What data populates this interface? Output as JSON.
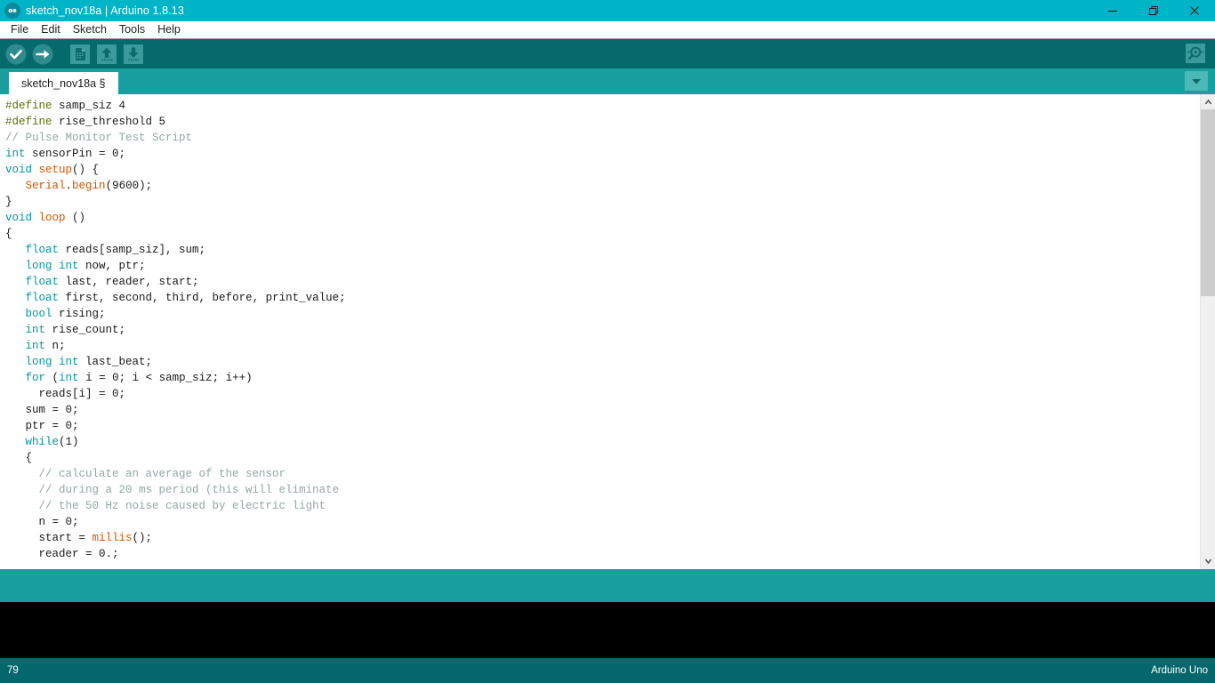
{
  "window": {
    "title": "sketch_nov18a | Arduino 1.8.13",
    "logo_icon": "arduino-infinity-icon",
    "controls": {
      "minimize": "minimize-icon",
      "maximize": "restore-icon",
      "close": "close-icon"
    }
  },
  "menubar": {
    "items": [
      {
        "label": "File"
      },
      {
        "label": "Edit"
      },
      {
        "label": "Sketch"
      },
      {
        "label": "Tools"
      },
      {
        "label": "Help"
      }
    ]
  },
  "toolbar": {
    "buttons": [
      {
        "name": "verify",
        "icon": "check-circle-icon",
        "tooltip": "Verify"
      },
      {
        "name": "upload",
        "icon": "arrow-right-circle-icon",
        "tooltip": "Upload"
      },
      {
        "name": "new",
        "icon": "new-file-icon",
        "tooltip": "New"
      },
      {
        "name": "open",
        "icon": "arrow-up-folder-icon",
        "tooltip": "Open"
      },
      {
        "name": "save",
        "icon": "arrow-down-save-icon",
        "tooltip": "Save"
      }
    ],
    "serial_monitor": {
      "name": "serial-monitor",
      "icon": "magnifier-icon",
      "tooltip": "Serial Monitor"
    }
  },
  "tabs": {
    "items": [
      {
        "label": "sketch_nov18a §",
        "active": true
      }
    ],
    "dropdown_icon": "chevron-down-icon"
  },
  "editor": {
    "lines": [
      [
        {
          "t": "pre",
          "s": "#define"
        },
        {
          "t": "plain",
          "s": " samp_siz 4"
        }
      ],
      [
        {
          "t": "pre",
          "s": "#define"
        },
        {
          "t": "plain",
          "s": " rise_threshold 5"
        }
      ],
      [
        {
          "t": "cmt",
          "s": "// Pulse Monitor Test Script"
        }
      ],
      [
        {
          "t": "key",
          "s": "int"
        },
        {
          "t": "plain",
          "s": " sensorPin = 0;"
        }
      ],
      [
        {
          "t": "key",
          "s": "void"
        },
        {
          "t": "fn",
          "s": " setup"
        },
        {
          "t": "plain",
          "s": "() {"
        }
      ],
      [
        {
          "t": "plain",
          "s": "   "
        },
        {
          "t": "fn",
          "s": "Serial"
        },
        {
          "t": "plain",
          "s": "."
        },
        {
          "t": "fn",
          "s": "begin"
        },
        {
          "t": "plain",
          "s": "(9600);"
        }
      ],
      [
        {
          "t": "plain",
          "s": "}"
        }
      ],
      [
        {
          "t": "key",
          "s": "void"
        },
        {
          "t": "fn",
          "s": " loop"
        },
        {
          "t": "plain",
          "s": " ()"
        }
      ],
      [
        {
          "t": "plain",
          "s": "{"
        }
      ],
      [
        {
          "t": "plain",
          "s": "   "
        },
        {
          "t": "key",
          "s": "float"
        },
        {
          "t": "plain",
          "s": " reads[samp_siz], sum;"
        }
      ],
      [
        {
          "t": "plain",
          "s": "   "
        },
        {
          "t": "key",
          "s": "long int"
        },
        {
          "t": "plain",
          "s": " now, ptr;"
        }
      ],
      [
        {
          "t": "plain",
          "s": "   "
        },
        {
          "t": "key",
          "s": "float"
        },
        {
          "t": "plain",
          "s": " last, reader, start;"
        }
      ],
      [
        {
          "t": "plain",
          "s": "   "
        },
        {
          "t": "key",
          "s": "float"
        },
        {
          "t": "plain",
          "s": " first, second, third, before, print_value;"
        }
      ],
      [
        {
          "t": "plain",
          "s": "   "
        },
        {
          "t": "key",
          "s": "bool"
        },
        {
          "t": "plain",
          "s": " rising;"
        }
      ],
      [
        {
          "t": "plain",
          "s": "   "
        },
        {
          "t": "key",
          "s": "int"
        },
        {
          "t": "plain",
          "s": " rise_count;"
        }
      ],
      [
        {
          "t": "plain",
          "s": "   "
        },
        {
          "t": "key",
          "s": "int"
        },
        {
          "t": "plain",
          "s": " n;"
        }
      ],
      [
        {
          "t": "plain",
          "s": "   "
        },
        {
          "t": "key",
          "s": "long int"
        },
        {
          "t": "plain",
          "s": " last_beat;"
        }
      ],
      [
        {
          "t": "plain",
          "s": "   "
        },
        {
          "t": "key",
          "s": "for"
        },
        {
          "t": "plain",
          "s": " ("
        },
        {
          "t": "key",
          "s": "int"
        },
        {
          "t": "plain",
          "s": " i = 0; i < samp_siz; i++)"
        }
      ],
      [
        {
          "t": "plain",
          "s": "     reads[i] = 0;"
        }
      ],
      [
        {
          "t": "plain",
          "s": "   sum = 0;"
        }
      ],
      [
        {
          "t": "plain",
          "s": "   ptr = 0;"
        }
      ],
      [
        {
          "t": "plain",
          "s": "   "
        },
        {
          "t": "key",
          "s": "while"
        },
        {
          "t": "plain",
          "s": "(1)"
        }
      ],
      [
        {
          "t": "plain",
          "s": "   {"
        }
      ],
      [
        {
          "t": "plain",
          "s": "     "
        },
        {
          "t": "cmt",
          "s": "// calculate an average of the sensor"
        }
      ],
      [
        {
          "t": "plain",
          "s": "     "
        },
        {
          "t": "cmt",
          "s": "// during a 20 ms period (this will eliminate"
        }
      ],
      [
        {
          "t": "plain",
          "s": "     "
        },
        {
          "t": "cmt",
          "s": "// the 50 Hz noise caused by electric light"
        }
      ],
      [
        {
          "t": "plain",
          "s": "     n = 0;"
        }
      ],
      [
        {
          "t": "plain",
          "s": "     start = "
        },
        {
          "t": "fn",
          "s": "millis"
        },
        {
          "t": "plain",
          "s": "();"
        }
      ],
      [
        {
          "t": "plain",
          "s": "     reader = 0.;"
        }
      ]
    ],
    "scrollbar": {
      "up_arrow_icon": "chevron-up-icon",
      "down_arrow_icon": "chevron-down-icon"
    }
  },
  "console": {
    "text": ""
  },
  "statusbar": {
    "line_number": "79",
    "board": "Arduino Uno"
  },
  "colors": {
    "titlebar": "#00b4c8",
    "toolbar": "#06696b",
    "tabbar": "#1a9fa0",
    "status_strip": "#1a9fa0",
    "console": "#000000",
    "statusbar": "#04676b",
    "keyword": "#00979c",
    "preprocessor": "#5e6d03",
    "comment": "#95a5a6",
    "function": "#d35400"
  }
}
